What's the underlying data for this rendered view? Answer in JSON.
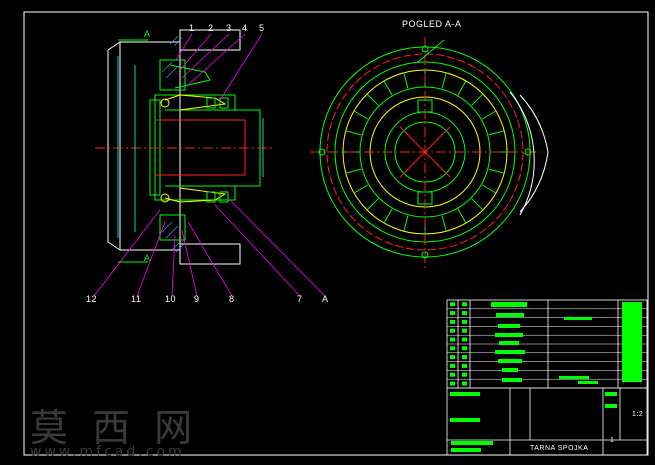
{
  "view_title": "POGLED A-A",
  "section_mark": "A",
  "part_numbers_top": [
    "1",
    "2",
    "3",
    "4",
    "5"
  ],
  "part_numbers_bottom": [
    "12",
    "11",
    "10",
    "9",
    "8",
    "7",
    "A"
  ],
  "title_block": {
    "drawing_title": "TARNA SPOJKA",
    "scale": "1:2",
    "sheet": "1"
  },
  "watermark": {
    "cn": "莫 西 网",
    "url": "www.mfcad.com"
  },
  "colors": {
    "frame": "#ffffff",
    "outline": "#00ff00",
    "inner": "#ffff00",
    "center": "#ff2020",
    "leader": "#ff00ff",
    "dim": "#00ffff",
    "hatch": "#3aa0ff"
  }
}
